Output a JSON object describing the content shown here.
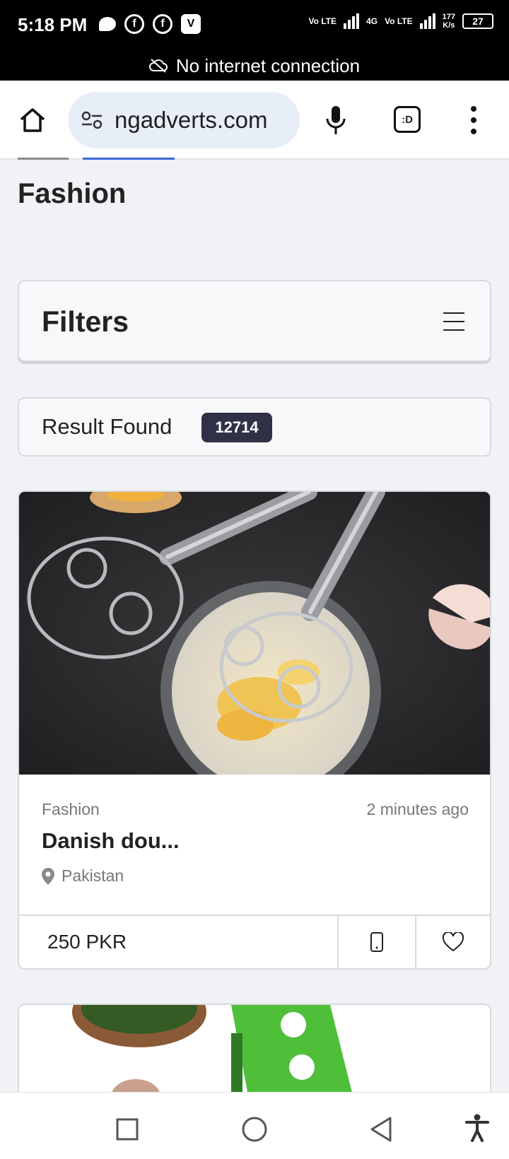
{
  "status_bar": {
    "time": "5:18 PM",
    "network_labels": [
      "Vo LTE",
      "4G",
      "Vo LTE"
    ],
    "speed_value": "177",
    "speed_unit": "K/s",
    "battery": "27"
  },
  "network_banner": {
    "text": "No internet connection",
    "icon": "cloud-off-icon"
  },
  "browser": {
    "url": "ngadverts.com",
    "tabs_label": ":D",
    "icons": [
      "home-icon",
      "tune-icon",
      "mic-icon",
      "tabs-icon",
      "more-vert-icon"
    ]
  },
  "page": {
    "title": "Fashion",
    "filters_label": "Filters",
    "results_label": "Result Found",
    "results_count": "12714"
  },
  "listings": [
    {
      "category": "Fashion",
      "posted": "2 minutes ago",
      "title": "Danish dou...",
      "location": "Pakistan",
      "price": "250 PKR"
    }
  ],
  "colors": {
    "badge_bg": "#2f3147",
    "page_bg": "#f1f2f6",
    "url_pill": "#e8eef7"
  }
}
